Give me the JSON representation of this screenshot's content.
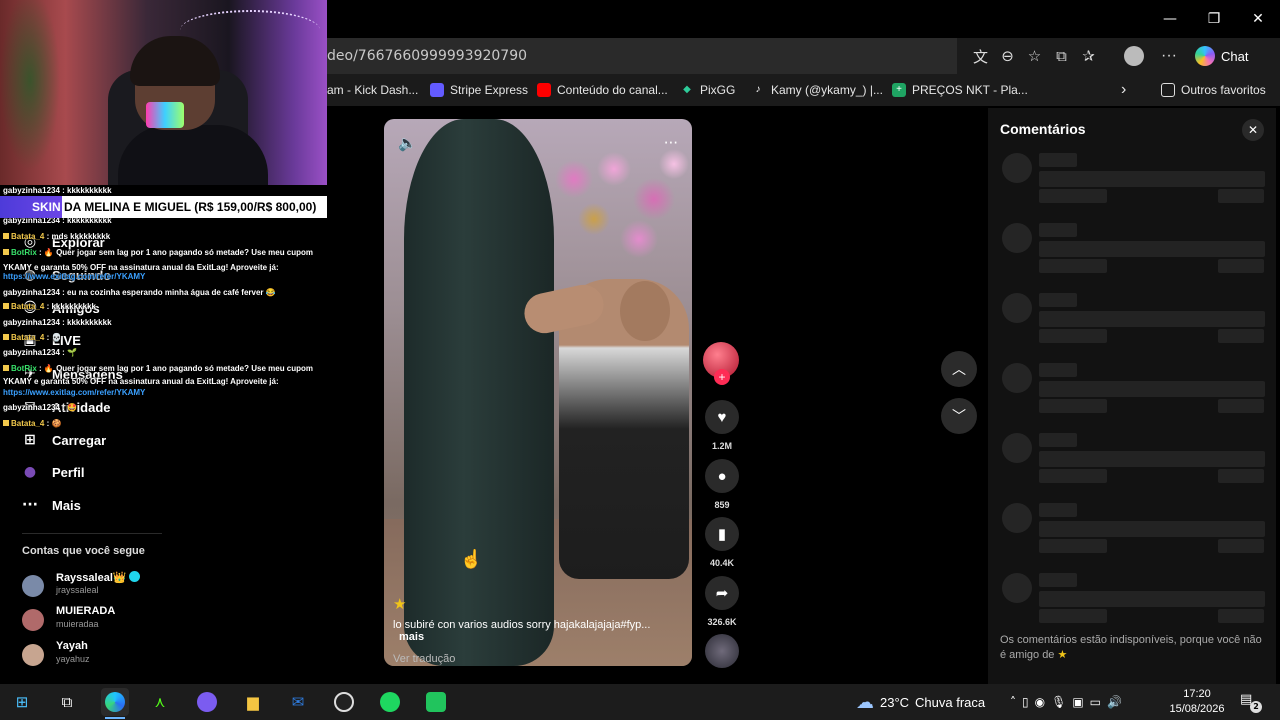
{
  "window": {
    "minimize": "—",
    "maximize": "❐",
    "close": "✕"
  },
  "address_bar": {
    "url": "deo/7667660999993920790",
    "icons": [
      "translate-icon",
      "zoom-icon",
      "star-icon",
      "extensions-icon",
      "favorites-icon"
    ],
    "chat_label": "Chat"
  },
  "bookmarks": [
    {
      "label": "am - Kick Dash..."
    },
    {
      "label": "Stripe Express"
    },
    {
      "label": "Conteúdo do canal..."
    },
    {
      "label": "PixGG"
    },
    {
      "label": "Kamy (@ykamy_) |..."
    },
    {
      "label": "PREÇOS NKT - Pla..."
    }
  ],
  "bookmarks_more": "›",
  "other_favorites": "Outros favoritos",
  "video": {
    "caption": "lo subiré con varios audios sorry hajakalajajaja#fyp...",
    "more_label": "mais",
    "translate_label": "Ver tradução"
  },
  "actions": {
    "likes": "1.2M",
    "comments": "859",
    "saves": "40.4K",
    "shares": "326.6K"
  },
  "comments_panel": {
    "title": "Comentários",
    "unavailable_note": "Os comentários estão indisponíveis, porque você não é amigo de",
    "star": "★"
  },
  "overlay": {
    "skin_banner": "SKIN DA MELINA E MIGUEL (R$ 159,00/R$ 800,00)",
    "skin_prefix": "SKIN"
  },
  "sidebar": {
    "items": [
      {
        "label": "Explorar",
        "icon": "◎"
      },
      {
        "label": "Seguindo",
        "icon": "◍"
      },
      {
        "label": "Amigos",
        "icon": "☺"
      },
      {
        "label": "LIVE",
        "icon": "▣"
      },
      {
        "label": "Mensagens",
        "icon": "✈"
      },
      {
        "label": "Atividade",
        "icon": "✉"
      },
      {
        "label": "Carregar",
        "icon": "⊞"
      },
      {
        "label": "Perfil",
        "icon": "●"
      },
      {
        "label": "Mais",
        "icon": "···"
      }
    ],
    "following_title": "Contas que você segue",
    "accounts": [
      {
        "name": "Rayssaleal👑",
        "handle": "jrayssaleal"
      },
      {
        "name": "MUIERADA",
        "handle": "muieradaa"
      },
      {
        "name": "Yayah",
        "handle": "yayahuz"
      }
    ]
  },
  "chat": [
    {
      "user": "gabyzinha1234",
      "text": " : kkkkkkkkkk",
      "kind": "u"
    },
    {
      "user": "gabyzinha1234",
      "text": " : kkkkkkkkkk",
      "kind": "u"
    },
    {
      "user": "Batata_4",
      "text": " : mds kkkkkkkkk",
      "kind": "ub"
    },
    {
      "user": "BotRix",
      "text": " : 🔥 Quer jogar sem lag por 1 ano pagando só metade? Use meu cupom",
      "kind": "ug"
    },
    {
      "user": "",
      "text": "YKAMY e garanta 50% OFF na assinatura anual da ExitLag! Aproveite já:",
      "kind": "u"
    },
    {
      "user": "",
      "text": "https://www.exitlag.com/refer/YKAMY",
      "kind": "lnk"
    },
    {
      "user": "gabyzinha1234",
      "text": " : eu na cozinha esperando minha água de café ferver 😂",
      "kind": "u"
    },
    {
      "user": "Batata_4",
      "text": " : kkkkkkkkkk",
      "kind": "ub"
    },
    {
      "user": "gabyzinha1234",
      "text": " : kkkkkkkkkk",
      "kind": "u"
    },
    {
      "user": "Batata_4",
      "text": " : 💀",
      "kind": "ub"
    },
    {
      "user": "gabyzinha1234",
      "text": " : 🌱",
      "kind": "u"
    },
    {
      "user": "BotRix",
      "text": " : 🔥 Quer jogar sem lag por 1 ano pagando só metade? Use meu cupom",
      "kind": "ug"
    },
    {
      "user": "",
      "text": "YKAMY e garanta 50% OFF na assinatura anual da ExitLag! Aproveite já:",
      "kind": "u"
    },
    {
      "user": "",
      "text": "https://www.exitlag.com/refer/YKAMY",
      "kind": "lnk"
    },
    {
      "user": "gabyzinha1234",
      "text": " : 🤩",
      "kind": "u"
    },
    {
      "user": "Batata_4",
      "text": " : 🍪",
      "kind": "ub"
    }
  ],
  "taskbar": {
    "weather_temp": "23°C",
    "weather_desc": "Chuva fraca",
    "time": "17:20",
    "date": "15/08/2026",
    "notifications": "2"
  }
}
